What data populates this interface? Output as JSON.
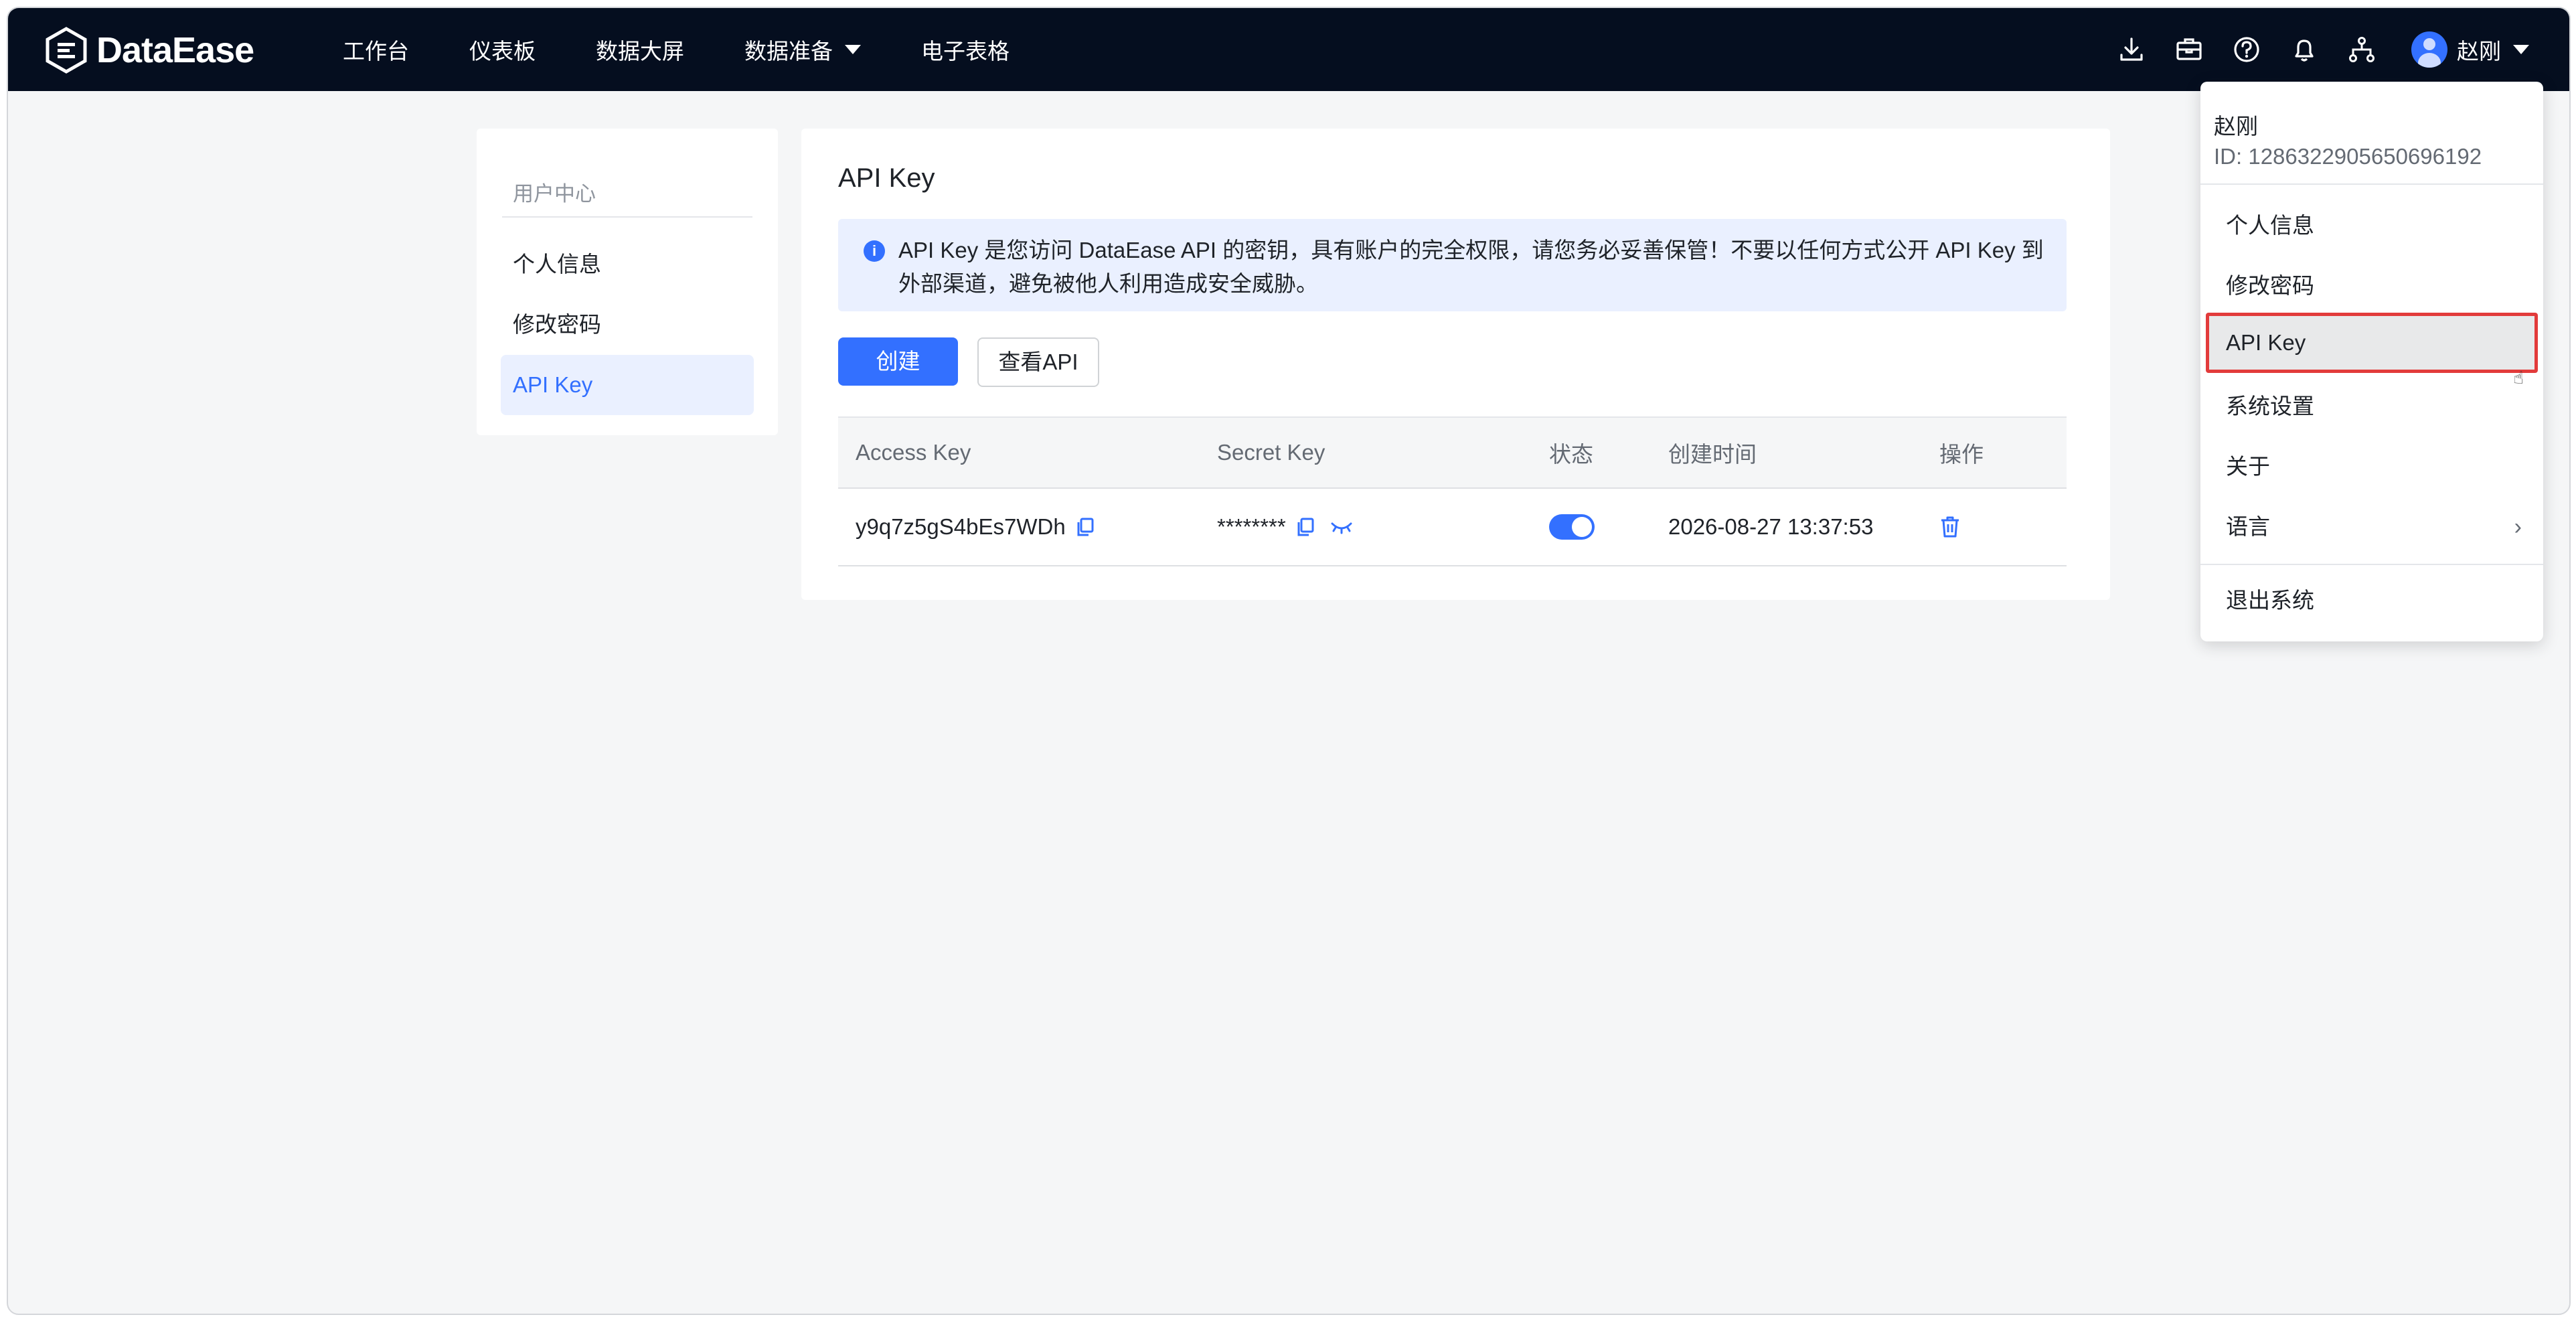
{
  "app": {
    "logo_text": "DataEase"
  },
  "nav": {
    "items": [
      {
        "label": "工作台"
      },
      {
        "label": "仪表板"
      },
      {
        "label": "数据大屏"
      },
      {
        "label": "数据准备",
        "has_dropdown": true
      },
      {
        "label": "电子表格"
      }
    ]
  },
  "header": {
    "user_name": "赵刚"
  },
  "sidebar": {
    "title": "用户中心",
    "items": [
      {
        "label": "个人信息"
      },
      {
        "label": "修改密码"
      },
      {
        "label": "API Key",
        "active": true
      }
    ]
  },
  "main": {
    "title": "API Key",
    "alert": "API Key 是您访问 DataEase API 的密钥，具有账户的完全权限，请您务必妥善保管！不要以任何方式公开 API Key 到外部渠道，避免被他人利用造成安全威胁。",
    "create_button": "创建",
    "view_api_button": "查看API",
    "table": {
      "columns": [
        "Access Key",
        "Secret Key",
        "状态",
        "创建时间",
        "操作"
      ],
      "rows": [
        {
          "access_key": "y9q7z5gS4bEs7WDh",
          "secret_key": "********",
          "status_on": true,
          "created": "2026-08-27 13:37:53"
        }
      ]
    }
  },
  "user_menu": {
    "name": "赵刚",
    "id_text": "ID: 1286322905650696192",
    "items": [
      {
        "label": "个人信息"
      },
      {
        "label": "修改密码"
      },
      {
        "label": "API Key",
        "highlighted": true
      },
      {
        "label": "系统设置"
      },
      {
        "label": "关于"
      },
      {
        "label": "语言",
        "has_submenu": true
      },
      {
        "label": "退出系统"
      }
    ]
  },
  "colors": {
    "accent": "#3370ff",
    "topbar": "#050e1f",
    "highlight_border": "#e23b3b"
  }
}
